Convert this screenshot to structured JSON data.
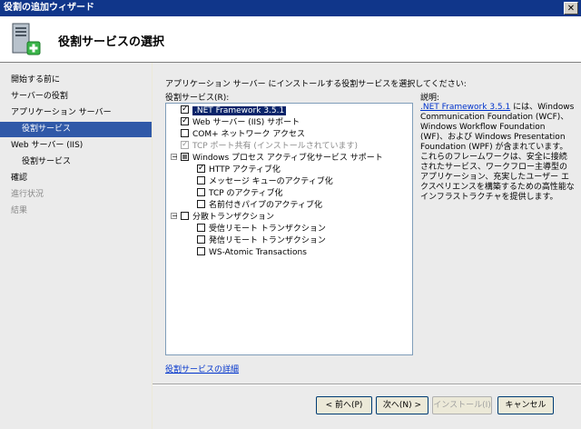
{
  "window": {
    "title": "役割の追加ウィザード",
    "close_label": "✕"
  },
  "header": {
    "title": "役割サービスの選択",
    "icon": "server-add-icon"
  },
  "nav": [
    {
      "label": "開始する前に",
      "state": "normal",
      "indent": 0
    },
    {
      "label": "サーバーの役割",
      "state": "normal",
      "indent": 0
    },
    {
      "label": "アプリケーション サーバー",
      "state": "normal",
      "indent": 0
    },
    {
      "label": "役割サービス",
      "state": "selected",
      "indent": 1
    },
    {
      "label": "Web サーバー (IIS)",
      "state": "normal",
      "indent": 0
    },
    {
      "label": "役割サービス",
      "state": "normal",
      "indent": 1
    },
    {
      "label": "確認",
      "state": "normal",
      "indent": 0
    },
    {
      "label": "進行状況",
      "state": "disabled",
      "indent": 0
    },
    {
      "label": "結果",
      "state": "disabled",
      "indent": 0
    }
  ],
  "main": {
    "intro": "アプリケーション サーバー にインストールする役割サービスを選択してください:",
    "list_label": "役割サービス(R):",
    "items": [
      {
        "label": ".NET Framework 3.5.1",
        "checked": true,
        "level": 0,
        "selected": true
      },
      {
        "label": "Web サーバー (IIS) サポート",
        "checked": true,
        "level": 0
      },
      {
        "label": "COM+ ネットワーク アクセス",
        "checked": false,
        "level": 0
      },
      {
        "label": "TCP ポート共有 (インストールされています)",
        "checked": true,
        "level": 0,
        "disabled": true
      },
      {
        "label": "Windows プロセス アクティブ化サービス サポート",
        "checked": "partial",
        "level": 0,
        "expander": "−"
      },
      {
        "label": "HTTP アクティブ化",
        "checked": true,
        "level": 1
      },
      {
        "label": "メッセージ キューのアクティブ化",
        "checked": false,
        "level": 1
      },
      {
        "label": "TCP のアクティブ化",
        "checked": false,
        "level": 1
      },
      {
        "label": "名前付きパイプのアクティブ化",
        "checked": false,
        "level": 1
      },
      {
        "label": "分散トランザクション",
        "checked": false,
        "level": 0,
        "expander": "−"
      },
      {
        "label": "受信リモート トランザクション",
        "checked": false,
        "level": 1
      },
      {
        "label": "発信リモート トランザクション",
        "checked": false,
        "level": 1
      },
      {
        "label": "WS-Atomic Transactions",
        "checked": false,
        "level": 1
      }
    ],
    "description_title": "説明:",
    "description_link": ".NET Framework 3.5.1",
    "description_text": " には、Windows Communication Foundation (WCF)、Windows Workflow Foundation (WF)、および Windows Presentation Foundation (WPF) が含まれています。これらのフレームワークは、安全に接続されたサービス、ワークフロー主導型のアプリケーション、充実したユーザー エクスペリエンスを構築するための高性能なインフラストラクチャを提供します。",
    "more_link": "役割サービスの詳細"
  },
  "buttons": {
    "back": "< 前へ(P)",
    "next": "次へ(N) >",
    "install": "インストール(I)",
    "cancel": "キャンセル"
  }
}
